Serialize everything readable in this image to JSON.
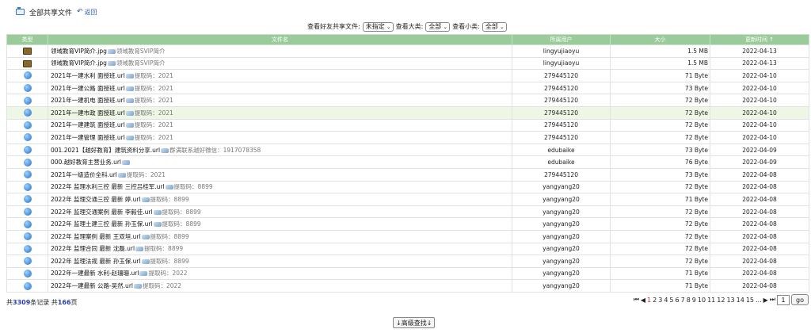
{
  "header": {
    "title": "全部共享文件",
    "back_label": "返回"
  },
  "filters": [
    {
      "label": "查看好友共享文件:",
      "value": "未指定"
    },
    {
      "label": "查看大类:",
      "value": "全部"
    },
    {
      "label": "查看小类:",
      "value": "全部"
    }
  ],
  "table": {
    "columns": [
      "类型",
      "文件名",
      "所属用户",
      "大小",
      "更新时间"
    ],
    "sort_indicator": "↑",
    "rows": [
      {
        "type": "image",
        "name": "领域教育VIP简介.jpg",
        "note": "领域教育SVIP简介",
        "user": "lingyujiaoyu",
        "size": "1.5 MB",
        "date": "2022-04-13"
      },
      {
        "type": "image",
        "name": "领域教育VIP简介.jpg",
        "note": "领域教育SVIP简介",
        "user": "lingyujiaoyu",
        "size": "1.5 MB",
        "date": "2022-04-13"
      },
      {
        "type": "web",
        "name": "2021年一建水利 面授班.url",
        "note": "提取码：2021",
        "user": "279445120",
        "size": "71 Byte",
        "date": "2022-04-10"
      },
      {
        "type": "web",
        "name": "2021年一建公路 面授班.url",
        "note": "提取码：2021",
        "user": "279445120",
        "size": "73 Byte",
        "date": "2022-04-10"
      },
      {
        "type": "web",
        "name": "2021年一建机电 面授班.url",
        "note": "提取码：2021",
        "user": "279445120",
        "size": "72 Byte",
        "date": "2022-04-10"
      },
      {
        "type": "web",
        "name": "2021年一建市政 面授班.url",
        "note": "提取码：2021",
        "user": "279445120",
        "size": "72 Byte",
        "date": "2022-04-10",
        "highlight": true
      },
      {
        "type": "web",
        "name": "2021年一建建筑 面授班.url",
        "note": "提取码：2021",
        "user": "279445120",
        "size": "72 Byte",
        "date": "2022-04-10"
      },
      {
        "type": "web",
        "name": "2021年一建管理 面授班.url",
        "note": "提取码：2021",
        "user": "279445120",
        "size": "72 Byte",
        "date": "2022-04-10"
      },
      {
        "type": "web",
        "name": "001.2021【越好教育】建筑资料分享.url",
        "note": "群满联系越好微信：1917078358",
        "user": "edubaike",
        "size": "73 Byte",
        "date": "2022-04-09"
      },
      {
        "type": "web",
        "name": "000.越好教育主营业务.url",
        "note": "",
        "user": "edubaike",
        "size": "76 Byte",
        "date": "2022-04-09"
      },
      {
        "type": "web",
        "name": "2021年一级造价全科.url",
        "note": "提取码：2021",
        "user": "279445120",
        "size": "73 Byte",
        "date": "2022-04-08"
      },
      {
        "type": "web",
        "name": "2022年 监理水利三控 最新 三控吕桂军.url",
        "note": "提取码：8899",
        "user": "yangyang20",
        "size": "72 Byte",
        "date": "2022-04-08"
      },
      {
        "type": "web",
        "name": "2022年 监理交通三控 最新 婷.url",
        "note": "提取码：8899",
        "user": "yangyang20",
        "size": "71 Byte",
        "date": "2022-04-08"
      },
      {
        "type": "web",
        "name": "2022年 监理交通案例 最新 李毅佳.url",
        "note": "提取码：8899",
        "user": "yangyang20",
        "size": "72 Byte",
        "date": "2022-04-08"
      },
      {
        "type": "web",
        "name": "2022年 监理土建三控 最新 孙玉保.url",
        "note": "提取码：8899",
        "user": "yangyang20",
        "size": "72 Byte",
        "date": "2022-04-08"
      },
      {
        "type": "web",
        "name": "2022年 监理案例 最新 王双垣.url",
        "note": "提取码：8899",
        "user": "yangyang20",
        "size": "72 Byte",
        "date": "2022-04-08"
      },
      {
        "type": "web",
        "name": "2022年 监理合同 最新 沈磊.url",
        "note": "提取码：8899",
        "user": "yangyang20",
        "size": "72 Byte",
        "date": "2022-04-08"
      },
      {
        "type": "web",
        "name": "2022年 监理法规 最新 孙玉保.url",
        "note": "提取码：8899",
        "user": "yangyang20",
        "size": "72 Byte",
        "date": "2022-04-08"
      },
      {
        "type": "web",
        "name": "2022年一建最新 水利-赵珊珊.url",
        "note": "提取码：2022",
        "user": "yangyang20",
        "size": "71 Byte",
        "date": "2022-04-08"
      },
      {
        "type": "web",
        "name": "2022年一建最新 公路-吴然.url",
        "note": "提取码：2022",
        "user": "yangyang20",
        "size": "71 Byte",
        "date": "2022-04-08"
      }
    ]
  },
  "footer": {
    "prefix": "共",
    "records": "3309",
    "mid": "条记录 共",
    "pages": "166",
    "suffix": "页"
  },
  "pager": {
    "first": "⏮",
    "prev": "◀",
    "pages": [
      "1",
      "2",
      "3",
      "4",
      "5",
      "6",
      "7",
      "8",
      "9",
      "10",
      "11",
      "12",
      "13",
      "14",
      "15",
      "..."
    ],
    "current": "1",
    "next": "▶",
    "last": "⏭",
    "input_value": "1",
    "go_label": "go"
  },
  "advanced_search_label": "↓高级查找↓"
}
